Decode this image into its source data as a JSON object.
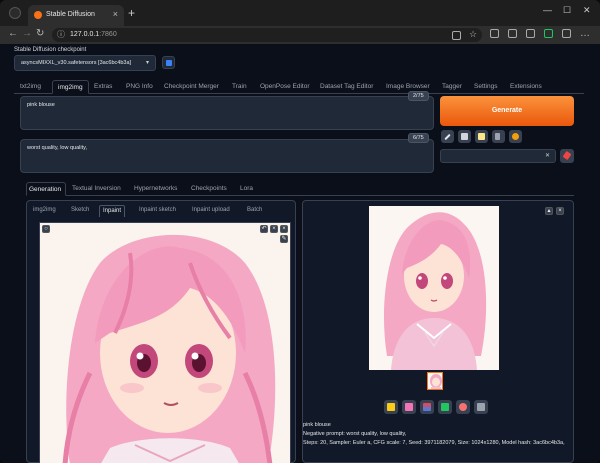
{
  "browser": {
    "tab_title": "Stable Diffusion",
    "url_host": "127.0.0.1",
    "url_port": ":7860",
    "colors": {
      "chrome_bg": "#1e1e1e",
      "tab_active": "#2e2e2e"
    }
  },
  "checkpoint": {
    "label": "Stable Diffusion checkpoint",
    "value": "asyncsMIXXL_v30.safetensors [3ac6bc4b3a]"
  },
  "main_tabs": [
    {
      "label": "txt2img"
    },
    {
      "label": "img2img"
    },
    {
      "label": "Extras"
    },
    {
      "label": "PNG Info"
    },
    {
      "label": "Checkpoint Merger"
    },
    {
      "label": "Train"
    },
    {
      "label": "OpenPose Editor"
    },
    {
      "label": "Dataset Tag Editor"
    },
    {
      "label": "Image Browser"
    },
    {
      "label": "Tagger"
    },
    {
      "label": "Settings"
    },
    {
      "label": "Extensions"
    }
  ],
  "prompt": {
    "positive": "pink blouse",
    "positive_count": "2/75",
    "negative": "worst quality, low quality,",
    "negative_count": "6/75"
  },
  "generate_label": "Generate",
  "tool_icons": [
    "arrow-diagonal-icon",
    "trash-icon",
    "clipboard-icon",
    "style-apply-icon",
    "extra-networks-icon"
  ],
  "styles_clear_icon": "✕",
  "sub_tabs": [
    {
      "label": "Generation"
    },
    {
      "label": "Textual Inversion"
    },
    {
      "label": "Hypernetworks"
    },
    {
      "label": "Checkpoints"
    },
    {
      "label": "Lora"
    }
  ],
  "image_tabs": [
    {
      "label": "img2img"
    },
    {
      "label": "Sketch"
    },
    {
      "label": "Inpaint"
    },
    {
      "label": "Inpaint sketch"
    },
    {
      "label": "Inpaint upload"
    },
    {
      "label": "Batch"
    }
  ],
  "output_actions": [
    "folder-icon",
    "save-icon",
    "zip-icon",
    "send-to-img2img-icon",
    "send-to-inpaint-icon",
    "send-to-extras-icon"
  ],
  "generation_info": {
    "line1": "pink blouse",
    "line2": "Negative prompt: worst quality, low quality,",
    "line3": "Steps: 20, Sampler: Euler a, CFG scale: 7, Seed: 3971182079, Size: 1024x1280, Model hash: 3ac6bc4b3a,"
  },
  "colors": {
    "page_bg": "#0b0f19",
    "accent": "#f97316",
    "panel": "#111827",
    "border": "#374151"
  }
}
